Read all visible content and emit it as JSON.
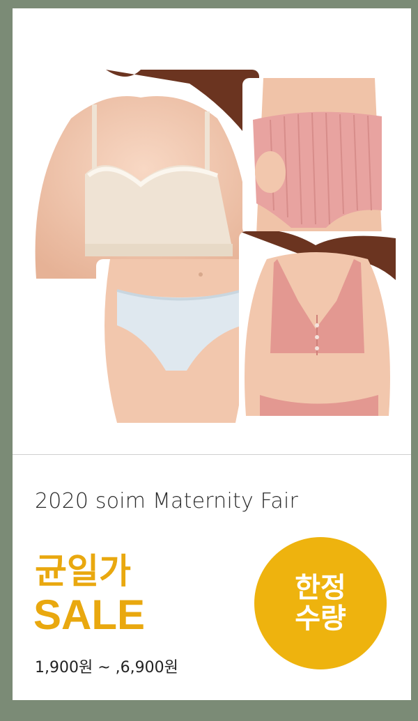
{
  "banner": {
    "subtitle": "2020 soim Maternity Fair",
    "sale_line1": "균일가",
    "sale_line2": "SALE",
    "price_range": "1,900원 ~ ,6,900원",
    "badge_line1": "한정",
    "badge_line2": "수량"
  },
  "photos": [
    {
      "name": "cream-nursing-bra-photo",
      "garment_color": "#efe3d4"
    },
    {
      "name": "pink-maternity-briefs-photo",
      "garment_color": "#e8a3a0"
    },
    {
      "name": "light-blue-panties-photo",
      "garment_color": "#dfe8ef"
    },
    {
      "name": "pink-front-button-bra-photo",
      "garment_color": "#e39891"
    }
  ],
  "colors": {
    "frame": "#7b8b76",
    "accent": "#e9a80f",
    "badge": "#eeb30e",
    "skin": "#f2c7ad",
    "hair": "#6b3420"
  }
}
